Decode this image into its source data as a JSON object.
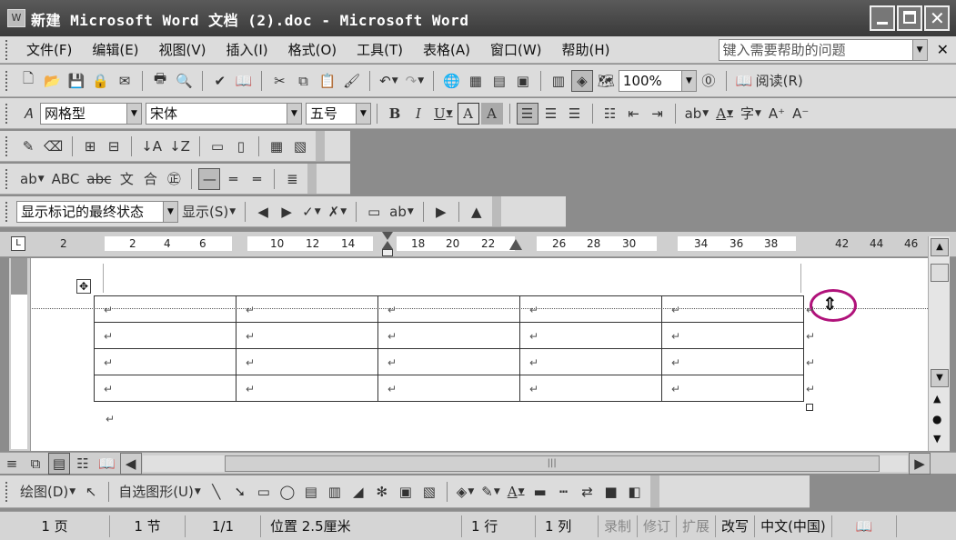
{
  "window": {
    "title": "新建 Microsoft Word 文档 (2).doc - Microsoft Word"
  },
  "menubar": {
    "items": [
      "文件(F)",
      "编辑(E)",
      "视图(V)",
      "插入(I)",
      "格式(O)",
      "工具(T)",
      "表格(A)",
      "窗口(W)",
      "帮助(H)"
    ],
    "help_placeholder": "键入需要帮助的问题"
  },
  "standard": {
    "zoom": "100%",
    "read_label": "阅读(R)"
  },
  "formatting": {
    "style": "网格型",
    "font": "宋体",
    "size": "五号",
    "bold": "B",
    "italic": "I",
    "underline": "U",
    "border_a": "A",
    "shade_a": "A"
  },
  "reviewing": {
    "markup_state": "显示标记的最终状态",
    "show_label": "显示(S)"
  },
  "ruler": {
    "marks": [
      "2",
      "2",
      "4",
      "6",
      "10",
      "12",
      "14",
      "18",
      "20",
      "22",
      "26",
      "28",
      "30",
      "34",
      "36",
      "38",
      "42",
      "44",
      "46"
    ]
  },
  "table": {
    "rows": 4,
    "cols": 5,
    "cell_mark": "↵"
  },
  "drawing": {
    "draw_label": "绘图(D)",
    "autoshapes_label": "自选图形(U)"
  },
  "status": {
    "page": "1 页",
    "section": "1 节",
    "pages": "1/1",
    "position": "位置 2.5厘米",
    "line": "1 行",
    "col": "1 列",
    "rec": "录制",
    "trk": "修订",
    "ext": "扩展",
    "ovr": "改写",
    "lang": "中文(中国)"
  }
}
